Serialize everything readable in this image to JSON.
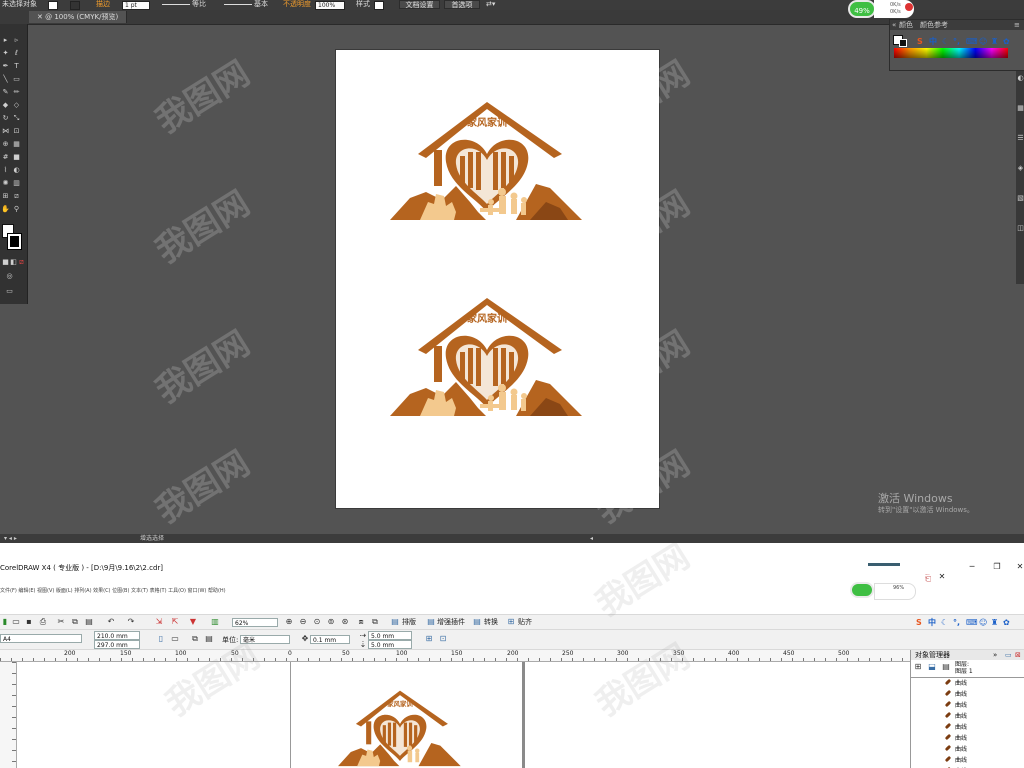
{
  "illustrator": {
    "control": {
      "selection": "未选择对象",
      "stroke_label": "描边",
      "stroke_weight": "1 pt",
      "profile_label": "等比",
      "brush_label": "基本",
      "opacity_label": "不透明度",
      "opacity_value": "100%",
      "style_label": "样式",
      "doc_setup_button": "文档设置",
      "prefs_button": "首选项"
    },
    "document_tab": "@ 100% (CMYK/预览)",
    "status_text": "增选选择",
    "color_panel": {
      "tab_color": "颜色",
      "tab_color_guide": "颜色参考"
    },
    "badge_percent": "49%",
    "net_up": "0K/s",
    "net_down": "0K/s",
    "activation": {
      "line1": "激活 Windows",
      "line2": "转到\"设置\"以激活 Windows。"
    },
    "artwork": {
      "heading": "家风家训",
      "colors": {
        "brown": "#b5641f",
        "light": "#f3c98e",
        "dark": "#8a4715"
      }
    }
  },
  "coreldraw": {
    "title": "CorelDRAW X4 ( 专业版 ) - [D:\\9月\\9.16\\2\\2.cdr]",
    "menu_text": "文件(F)  编辑(E)  视图(V)  版面(L)  排列(A)  效果(C)  位图(B)  文本(T)  表格(T)  工具(O)  窗口(W)  帮助(H)",
    "zoom": "62%",
    "toolbar_buttons": [
      "排版",
      "增强插件",
      "转换",
      "贴齐"
    ],
    "paper": "A4",
    "width": "210.0 mm",
    "height": "297.0 mm",
    "unit_label": "单位:",
    "unit_value": "毫米",
    "nudge": "0.1 mm",
    "dup_x": "5.0 mm",
    "dup_y": "5.0 mm",
    "ruler_labels": [
      "200",
      "150",
      "100",
      "50",
      "0",
      "50",
      "100",
      "150",
      "200",
      "250",
      "300",
      "350",
      "400",
      "450",
      "500"
    ],
    "objmgr": {
      "title": "对象管理器",
      "page_label": "图层:",
      "layer_label": "图层 1",
      "items": [
        "曲线",
        "曲线",
        "曲线",
        "曲线",
        "曲线",
        "曲线",
        "曲线",
        "曲线",
        "曲线"
      ]
    },
    "badge_percent": "96%",
    "net_up": "0K/s",
    "net_down": "0K/s"
  },
  "watermark": "我图网",
  "ime_labels": [
    "中",
    "拼"
  ]
}
